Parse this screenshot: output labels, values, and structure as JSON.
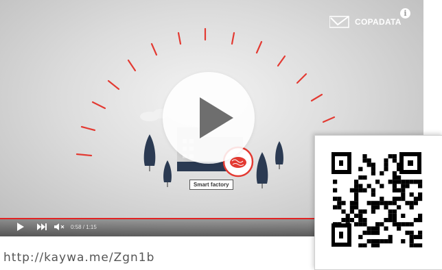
{
  "video": {
    "brand": "COPADATA",
    "overlay_label": "Smart factory",
    "time": "0:58 / 1:15",
    "progress": 0.77
  },
  "colors": {
    "accent": "#e22222",
    "tree": "#2b3a52"
  },
  "icons": [
    "copadata-logo-icon",
    "info-icon",
    "play-icon",
    "next-icon",
    "volume-icon",
    "brain-icon"
  ],
  "link": {
    "url": "http://kaywa.me/Zgn1b"
  }
}
